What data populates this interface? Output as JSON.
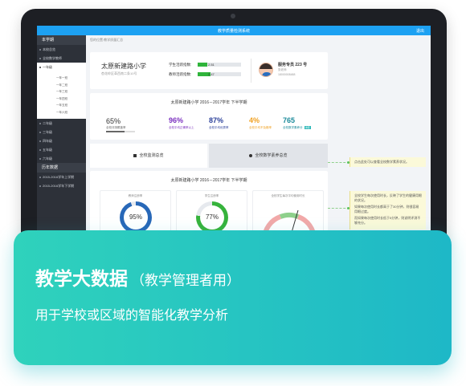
{
  "topbar": {
    "title": "教学质量检测系统",
    "exit": "退出"
  },
  "breadcrumb": "您的位置:教学质量汇总",
  "sidebar": {
    "section1": "本学期",
    "items": [
      "本校总览",
      "全校数学教师",
      "一年级"
    ],
    "grade1_classes": [
      "一年一班",
      "一年二班",
      "一年三班",
      "一年四班",
      "一年五班",
      "一年六班"
    ],
    "more_grades": [
      "二年级",
      "三年级",
      "四年级",
      "五年级",
      "六年级"
    ],
    "section2": "历年数据",
    "history": [
      "2015-2016学年上学期",
      "2015-2016学年下学期"
    ]
  },
  "school": {
    "name": "太原新建路小学",
    "address": "杏花岭区革西南二条10号",
    "student_label": "学生活跃指数:",
    "student_value": "2.51",
    "student_fill": 0.22,
    "teacher_label": "教师活跃指数:",
    "teacher_value": "2.47",
    "teacher_fill": 0.3,
    "expert_name": "服务专员 223 号",
    "expert_role": "张老师",
    "expert_phone": "18000008488"
  },
  "summary": {
    "title": "太原新建路小学  2016－2017学年 下半学期",
    "main_value": "65%",
    "main_label": "全校评测覆盖率",
    "metrics": [
      {
        "value": "96%",
        "label": "全校平均正确率以上",
        "color": "#7b2fbf"
      },
      {
        "value": "87%",
        "label": "全校平均优秀率",
        "color": "#2a3f9a"
      },
      {
        "value": "4%",
        "label": "全校平均不及格率",
        "color": "#f0a020"
      },
      {
        "value": "765",
        "label": "全校数学素养分",
        "color": "#1a8a9a",
        "tag": "详细"
      }
    ]
  },
  "tabs": {
    "monitor": "全校监测总览",
    "literacy": "全校数学素养总览"
  },
  "detail": {
    "title": "太原新建路小学  2016－2017学年 下半学期",
    "cards": [
      {
        "label": "教师注册率",
        "value": "95%",
        "fill": 95,
        "color": "#2868b8"
      },
      {
        "label": "学生注册率",
        "value": "77%",
        "fill": 77,
        "color": "#36b33c"
      },
      {
        "label": "全校学生每次平均使用时长",
        "value": ""
      }
    ]
  },
  "callouts": {
    "c1": "点击此处可以查看全校数学素养状况。",
    "c2a": "全校学生每次使用时长，反映了学生的健康用眼的状况。",
    "c2b": "如果每次使用时长都高于了30分钟，则很容易用眼过度。",
    "c2c": "而如果每次使用时长低于5分钟，则说明评测不够充分。"
  },
  "overlay": {
    "title": "教学大数据",
    "title_sub": "（教学管理者用）",
    "subtitle": "用于学校或区域的智能化教学分析"
  },
  "colors": {
    "accent": "#1da1f2",
    "overlay_start": "#2fd2bc",
    "overlay_end": "#1eb8c7"
  }
}
